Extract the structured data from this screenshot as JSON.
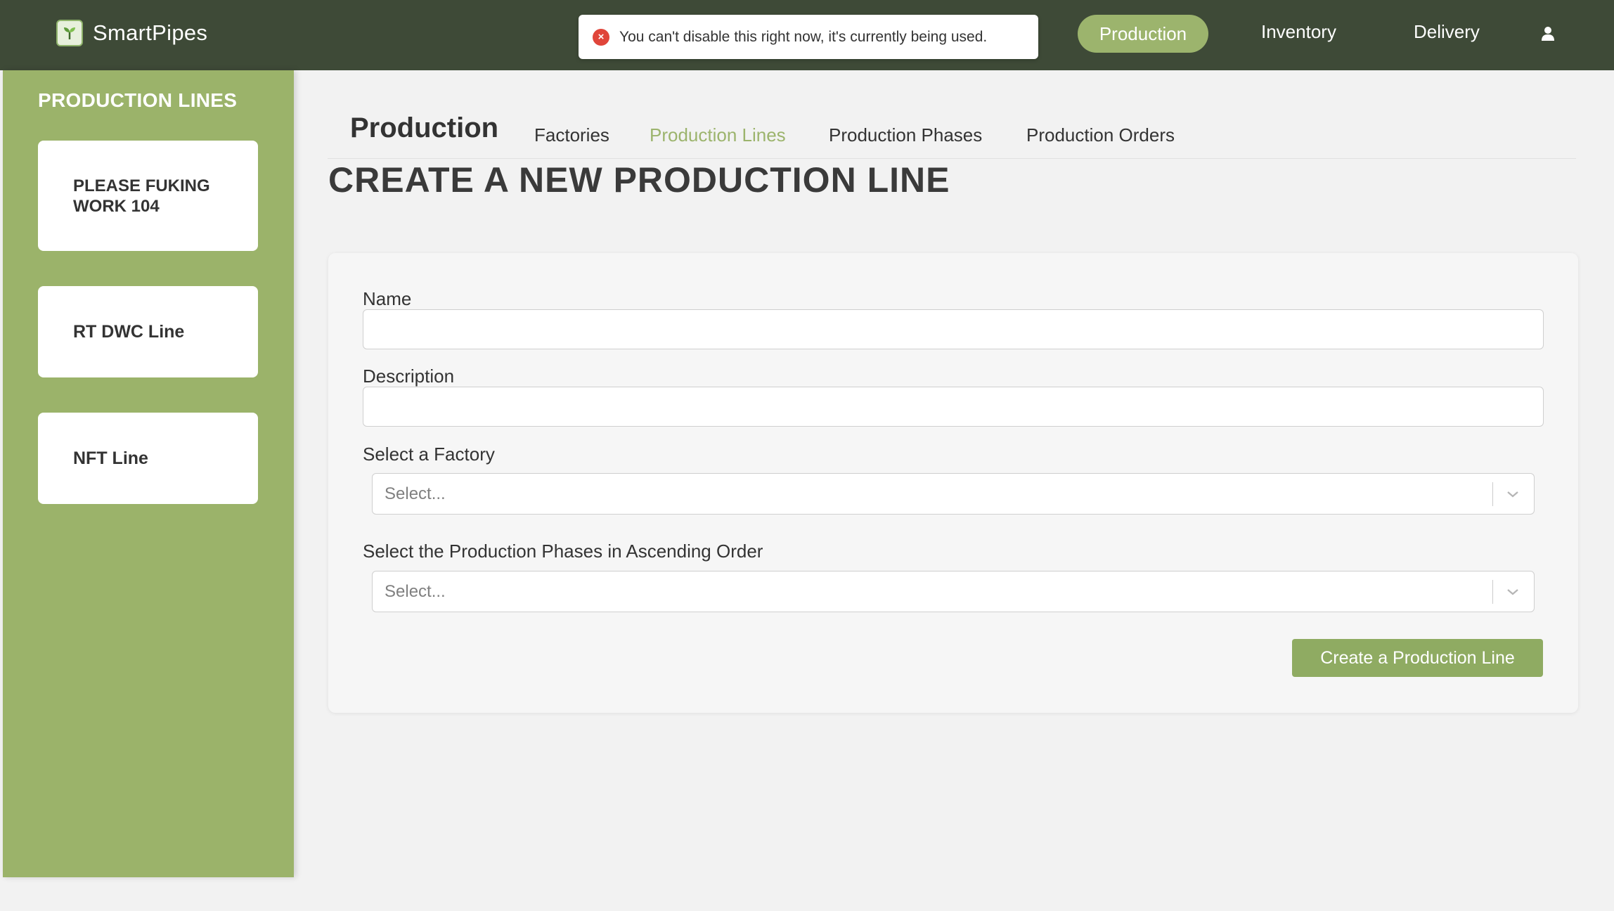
{
  "navbar": {
    "brand": "SmartPipes",
    "toast_message": "You can't disable this right now, it's currently being used.",
    "items": [
      {
        "label": "Production",
        "active": true
      },
      {
        "label": "Inventory"
      },
      {
        "label": "Delivery"
      }
    ],
    "user_icon": "user-icon"
  },
  "sidebar": {
    "title": "PRODUCTION LINES",
    "items": [
      {
        "label": "PLEASE FUKING WORK 104"
      },
      {
        "label": "RT DWC Line"
      },
      {
        "label": "NFT Line"
      }
    ]
  },
  "subnav": {
    "title": "Production",
    "tabs": [
      {
        "label": "Factories"
      },
      {
        "label": "Production Lines",
        "active": true
      },
      {
        "label": "Production Phases"
      },
      {
        "label": "Production Orders"
      }
    ]
  },
  "page": {
    "title": "CREATE A NEW PRODUCTION LINE"
  },
  "form": {
    "name_label": "Name",
    "name_value": "",
    "description_label": "Description",
    "description_value": "",
    "factory_label": "Select a Factory",
    "factory_placeholder": "Select...",
    "phases_label": "Select the Production Phases in Ascending Order",
    "phases_placeholder": "Select...",
    "submit_label": "Create a Production Line"
  },
  "colors": {
    "navbar": "#3e4a37",
    "accent": "#9cb46d",
    "sidebar": "#9bb36a",
    "button": "#8fab62",
    "error": "#e0453a"
  }
}
